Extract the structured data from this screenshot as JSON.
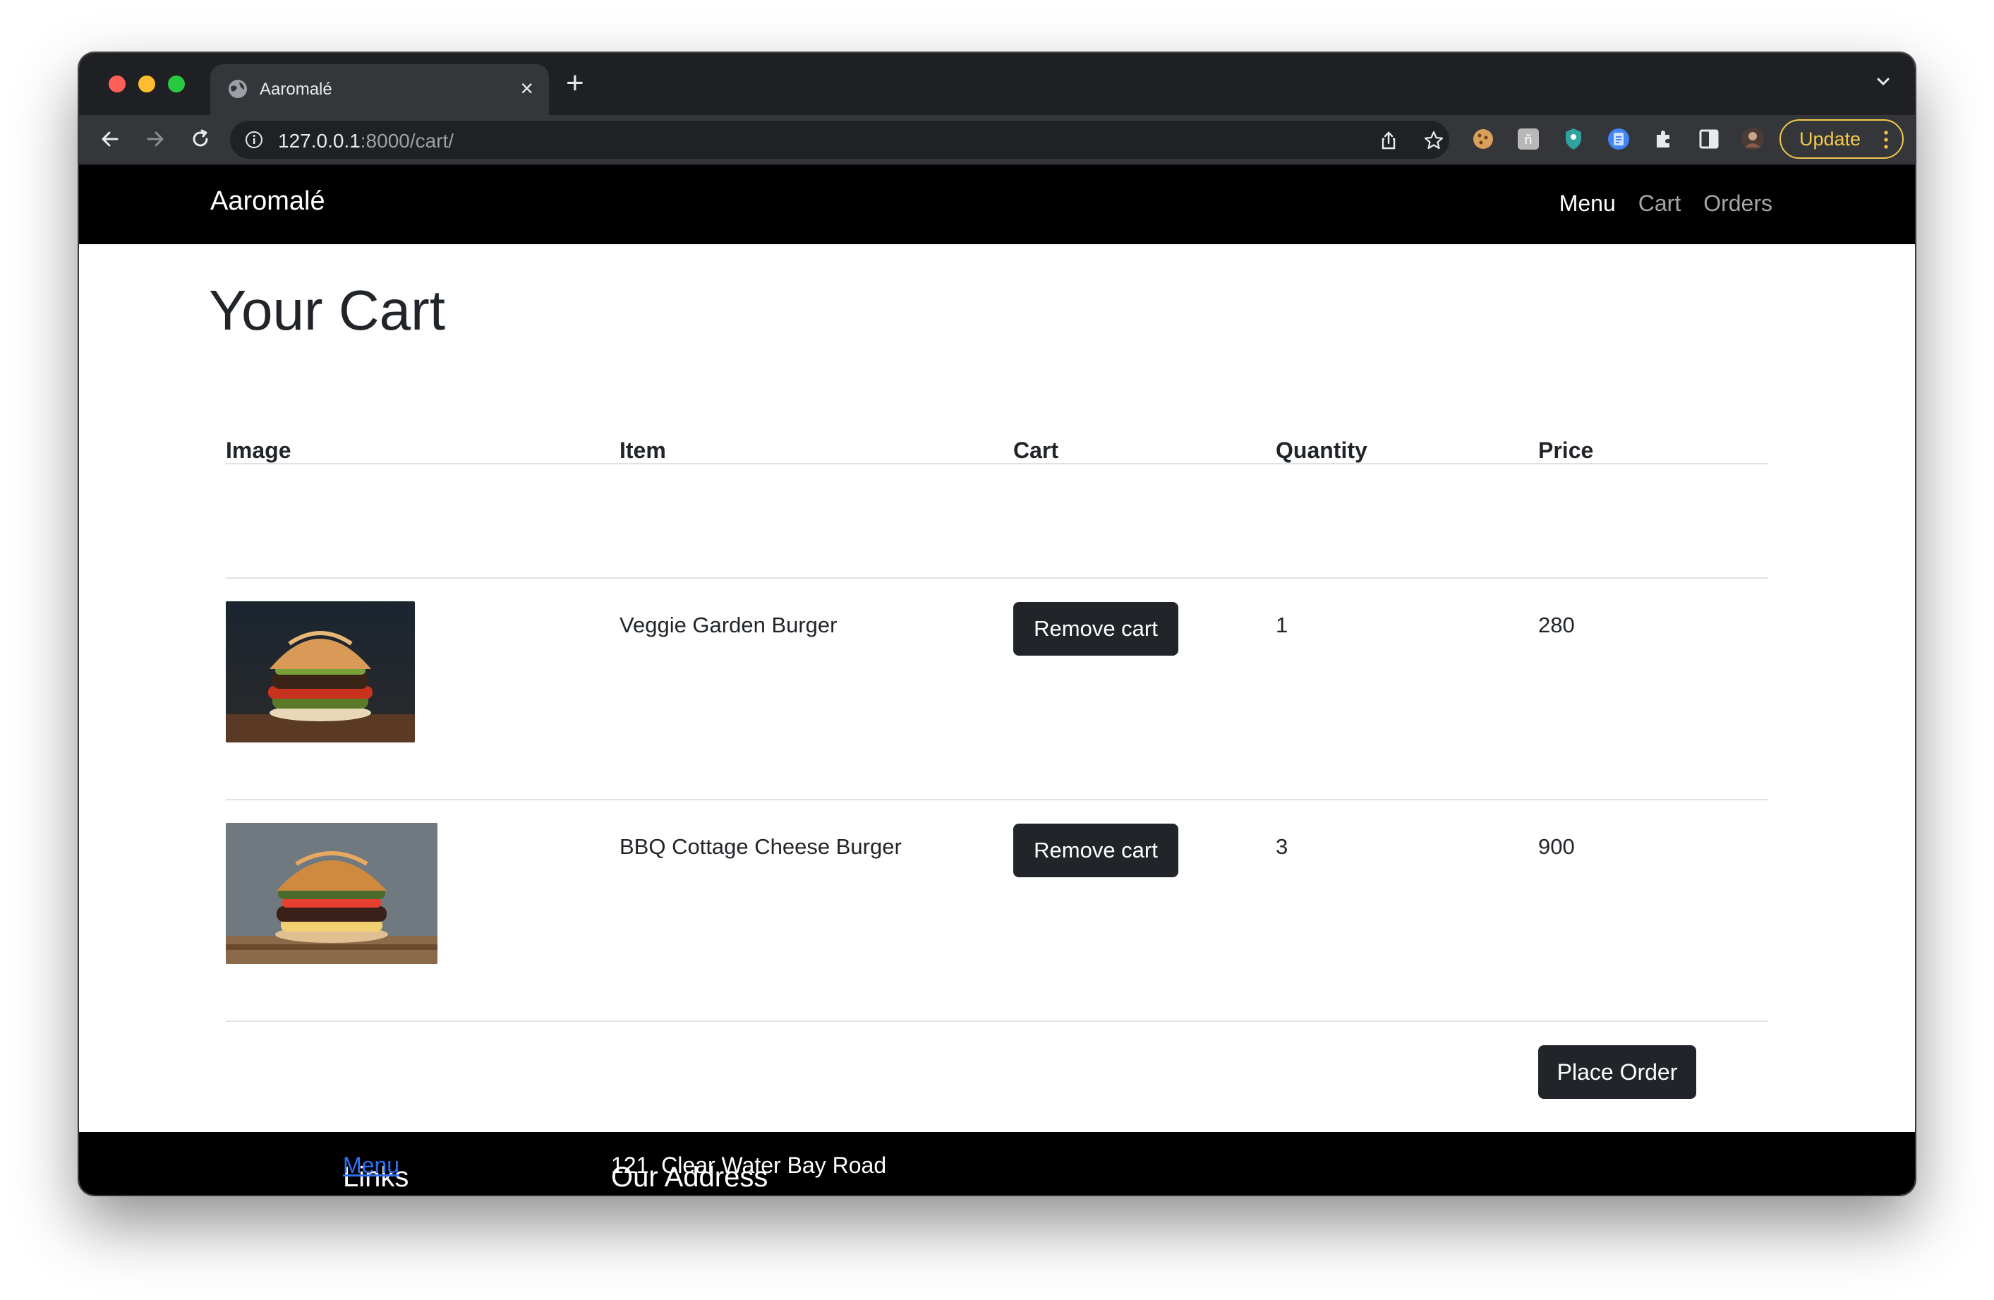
{
  "browser": {
    "tab_title": "Aaromalé",
    "url_host": "127.0.0.1",
    "url_path": ":8000/cart/",
    "update_label": "Update",
    "accent": "#f2c94c"
  },
  "site": {
    "brand": "Aaromalé",
    "nav": {
      "menu": "Menu",
      "cart": "Cart",
      "orders": "Orders"
    }
  },
  "cart": {
    "title": "Your Cart",
    "columns": {
      "image": "Image",
      "item": "Item",
      "cart": "Cart",
      "quantity": "Quantity",
      "price": "Price"
    },
    "rows": [
      {
        "item": "Veggie Garden Burger",
        "action": "Remove cart",
        "quantity": "1",
        "price": "280"
      },
      {
        "item": "BBQ Cottage Cheese Burger",
        "action": "Remove cart",
        "quantity": "3",
        "price": "900"
      }
    ],
    "place_order": "Place Order"
  },
  "footer": {
    "links_heading": "Links",
    "links": {
      "menu": "Menu"
    },
    "address_heading": "Our Address",
    "address_line": "121, Clear Water Bay Road"
  }
}
